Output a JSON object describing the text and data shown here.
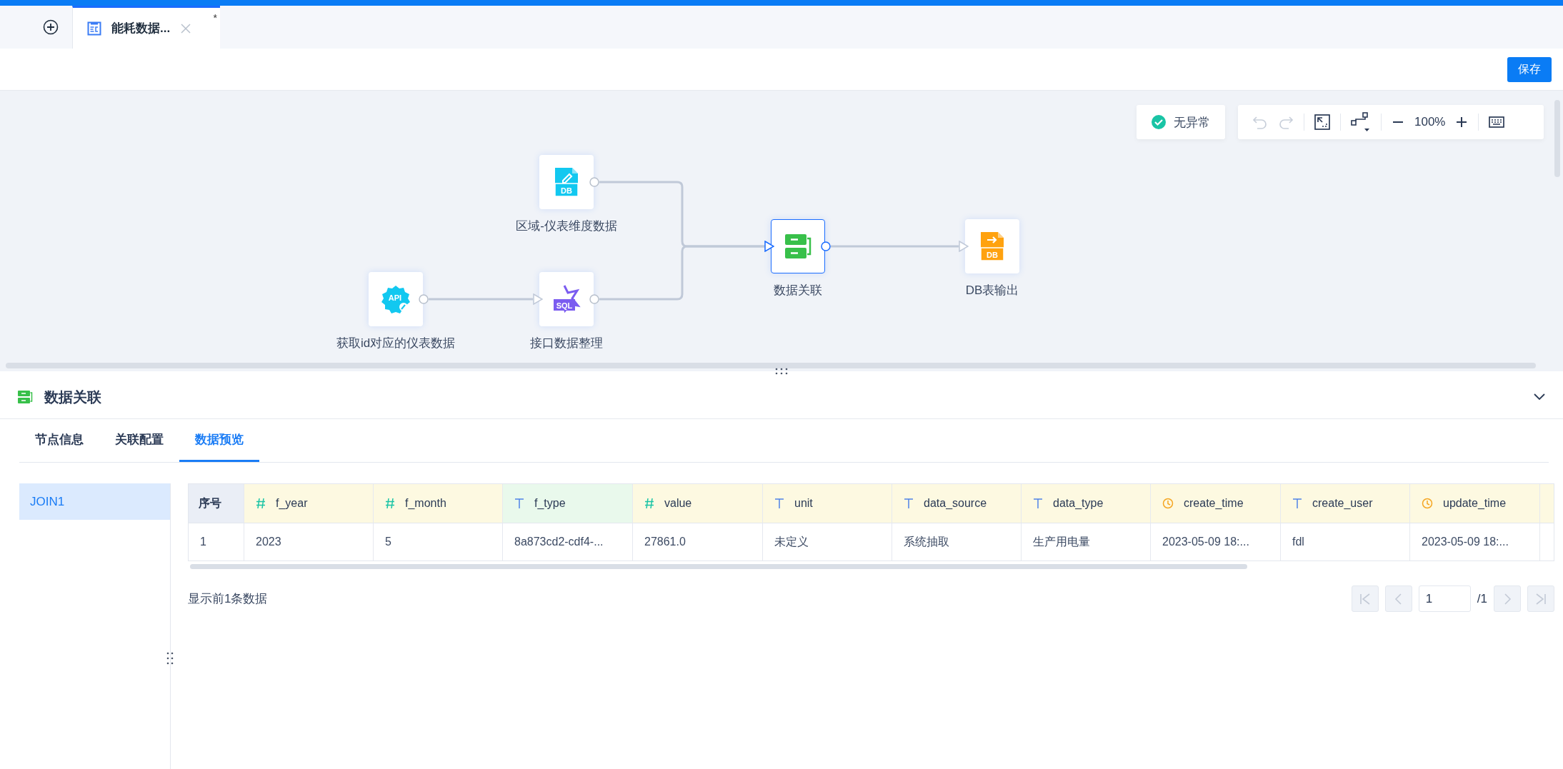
{
  "tab_bar": {
    "tabs": [
      {
        "title": "能耗数据...",
        "modified_mark": "*",
        "selected": true
      }
    ]
  },
  "toolbar": {
    "save_button": "保存"
  },
  "canvas": {
    "status": "无异常",
    "can_undo": false,
    "can_redo": false,
    "zoom": "100%",
    "nodes": [
      {
        "kind": "db-input",
        "icon_text": "DB",
        "label": "区域-仪表维度数据",
        "selected": false
      },
      {
        "kind": "api",
        "icon_text": "API",
        "label": "获取id对应的仪表数据",
        "selected": false
      },
      {
        "kind": "sql",
        "icon_text": "SQL",
        "label": "接口数据整理",
        "selected": false
      },
      {
        "kind": "join",
        "label": "数据关联",
        "selected": true
      },
      {
        "kind": "db-output",
        "icon_text": "DB",
        "label": "DB表输出",
        "selected": false
      }
    ]
  },
  "panel": {
    "title": "数据关联",
    "tabs": [
      {
        "label": "节点信息",
        "selected": false
      },
      {
        "label": "关联配置",
        "selected": false
      },
      {
        "label": "数据预览",
        "selected": true
      }
    ],
    "sources": [
      {
        "label": "JOIN1",
        "selected": true
      }
    ],
    "table": {
      "columns": [
        {
          "kind": "index",
          "name": "序号"
        },
        {
          "kind": "number",
          "name": "f_year",
          "highlighted": false
        },
        {
          "kind": "number",
          "name": "f_month",
          "highlighted": false
        },
        {
          "kind": "text",
          "name": "f_type",
          "highlighted": true
        },
        {
          "kind": "number",
          "name": "value",
          "highlighted": false
        },
        {
          "kind": "text",
          "name": "unit",
          "highlighted": false
        },
        {
          "kind": "text",
          "name": "data_source",
          "highlighted": false
        },
        {
          "kind": "text",
          "name": "data_type",
          "highlighted": false
        },
        {
          "kind": "time",
          "name": "create_time",
          "highlighted": false
        },
        {
          "kind": "text",
          "name": "create_user",
          "highlighted": false
        },
        {
          "kind": "time",
          "name": "update_time",
          "highlighted": false
        }
      ],
      "rows": [
        [
          "1",
          "2023",
          "5",
          "8a873cd2-cdf4-...",
          "27861.0",
          "未定义",
          "系统抽取",
          "生产用电量",
          "2023-05-09 18:...",
          "fdl",
          "2023-05-09 18:..."
        ]
      ]
    },
    "footer": "显示前1条数据",
    "pagination": {
      "page": "1",
      "total": "/1",
      "nav_disabled": true
    }
  }
}
